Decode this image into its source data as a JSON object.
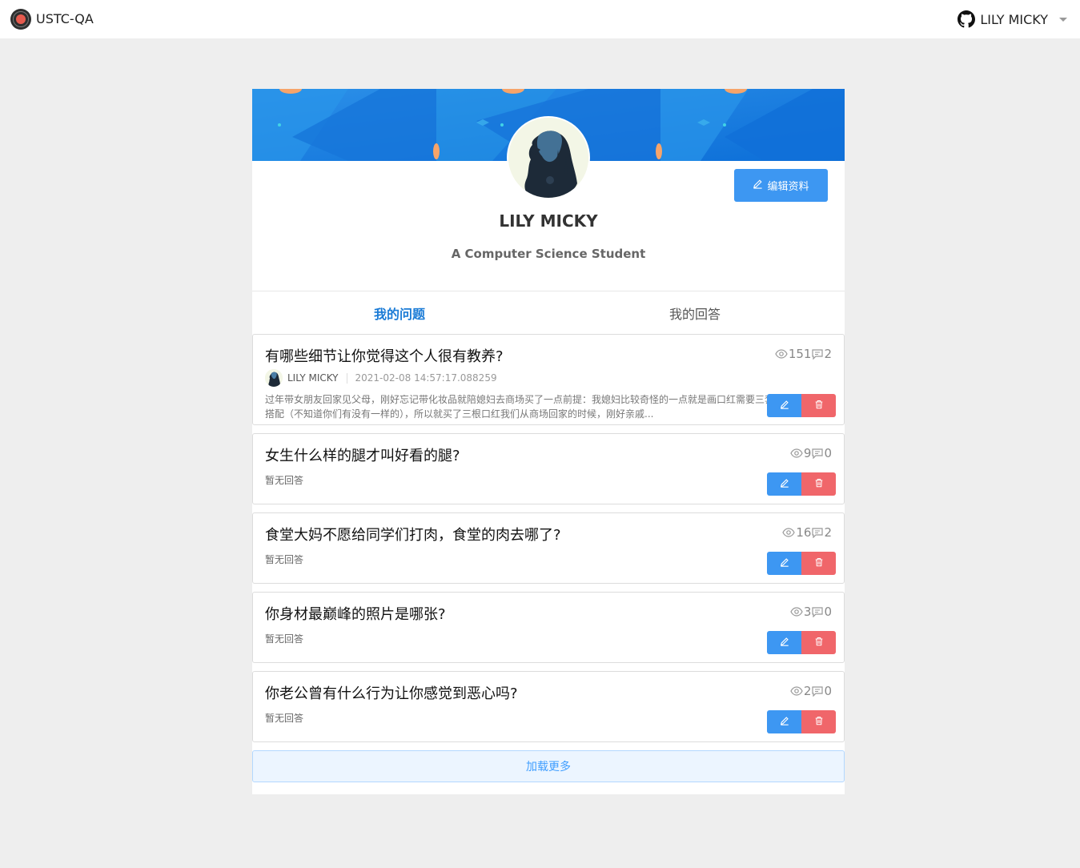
{
  "app": {
    "brand": "USTC-QA"
  },
  "header": {
    "user_name": "LILY MICKY"
  },
  "profile": {
    "name": "LILY MICKY",
    "bio": "A Computer Science Student",
    "edit_label": "编辑资料"
  },
  "tabs": [
    {
      "label": "我的问题",
      "active": true
    },
    {
      "label": "我的回答",
      "active": false
    }
  ],
  "questions": [
    {
      "title": "有哪些细节让你觉得这个人很有教养?",
      "views": "151",
      "answers": "2",
      "author": "LILY MICKY",
      "time": "2021-02-08 14:57:17.088259",
      "excerpt": "过年带女朋友回家见父母，刚好忘记带化妆品就陪媳妇去商场买了一点前提：我媳妇比较奇怪的一点就是画口红需要三套搭配（不知道你们有没有一样的），所以就买了三根口红我们从商场回家的时候，刚好亲戚..."
    },
    {
      "title": "女生什么样的腿才叫好看的腿?",
      "views": "9",
      "answers": "0",
      "no_answer": "暂无回答"
    },
    {
      "title": "食堂大妈不愿给同学们打肉，食堂的肉去哪了?",
      "views": "16",
      "answers": "2",
      "no_answer": "暂无回答"
    },
    {
      "title": "你身材最巅峰的照片是哪张?",
      "views": "3",
      "answers": "0",
      "no_answer": "暂无回答"
    },
    {
      "title": "你老公曾有什么行为让你感觉到恶心吗?",
      "views": "2",
      "answers": "0",
      "no_answer": "暂无回答"
    }
  ],
  "load_more": "加载更多",
  "colors": {
    "primary": "#3d97f2",
    "danger": "#f0666a",
    "active_tab": "#1a7bd6",
    "banner": "#1a7ee0"
  }
}
